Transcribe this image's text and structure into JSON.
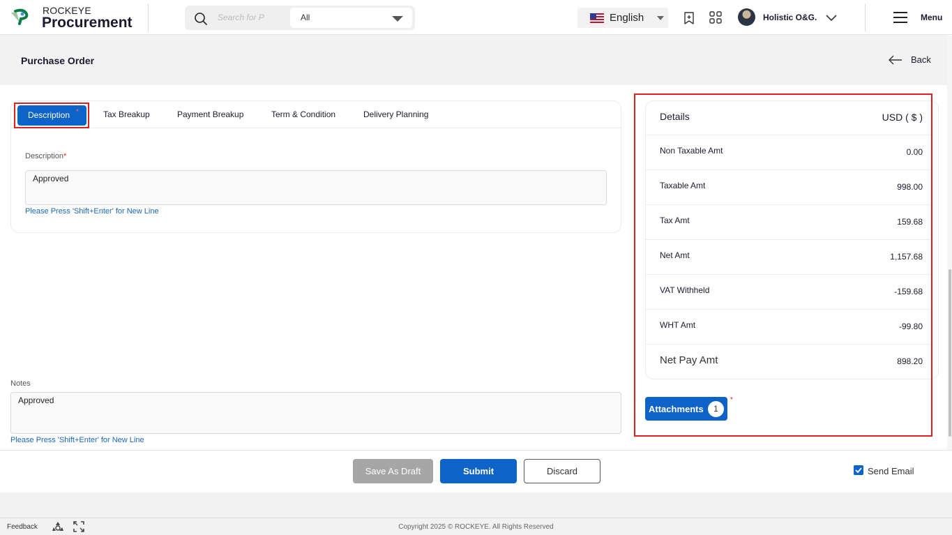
{
  "header": {
    "brand_top": "ROCKEYE",
    "brand_main": "Procurement",
    "search_placeholder": "Search for P",
    "search_scope": "All",
    "language": "English",
    "user_name": "Holistic O&G.",
    "menu_label": "Menu"
  },
  "page": {
    "title": "Purchase Order",
    "back_label": "Back"
  },
  "tabs": [
    {
      "label": "Description",
      "active": true
    },
    {
      "label": "Tax Breakup"
    },
    {
      "label": "Payment Breakup"
    },
    {
      "label": "Term & Condition"
    },
    {
      "label": "Delivery Planning"
    }
  ],
  "description": {
    "label": "Description",
    "required_mark": "*",
    "value": "Approved",
    "hint": "Please Press 'Shift+Enter' for New Line"
  },
  "notes": {
    "label": "Notes",
    "value": "Approved",
    "hint": "Please Press 'Shift+Enter' for New Line"
  },
  "details": {
    "title": "Details",
    "currency": "USD ( $ )",
    "rows": [
      {
        "label": "Non Taxable Amt",
        "value": "0.00"
      },
      {
        "label": "Taxable Amt",
        "value": "998.00"
      },
      {
        "label": "Tax Amt",
        "value": "159.68"
      },
      {
        "label": "Net Amt",
        "value": "1,157.68"
      },
      {
        "label": "VAT Withheld",
        "value": "-159.68"
      },
      {
        "label": "WHT Amt",
        "value": "-99.80"
      },
      {
        "label": "Net Pay Amt",
        "value": "898.20"
      }
    ]
  },
  "attachments": {
    "label": "Attachments",
    "count": "1",
    "required_mark": "*"
  },
  "actions": {
    "save_draft": "Save As Draft",
    "submit": "Submit",
    "discard": "Discard",
    "send_email": "Send Email",
    "send_email_checked": true
  },
  "footer": {
    "feedback": "Feedback",
    "copyright": "Copyright 2025 © ROCKEYE. All Rights Reserved"
  },
  "colors": {
    "primary": "#0d63c7",
    "highlight": "#e02020",
    "disabled": "#a6a6a6"
  }
}
